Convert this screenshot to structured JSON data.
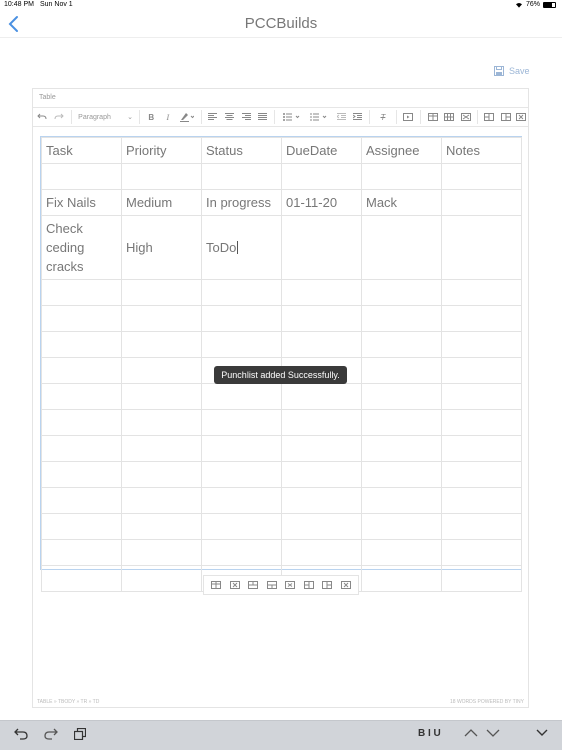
{
  "status_bar": {
    "time": "10:48 PM",
    "date": "Sun Nov 1",
    "battery": "76%",
    "battery_level": 0.76
  },
  "nav": {
    "title": "PCCBuilds",
    "back_icon": "chevron-left-icon"
  },
  "save_label": "Save",
  "editor": {
    "label": "Table",
    "block_format": "Paragraph",
    "table": {
      "headers": [
        "Task",
        "Priority",
        "Status",
        "DueDate",
        "Assignee",
        "Notes"
      ],
      "rows": [
        [
          "",
          "",
          "",
          "",
          "",
          ""
        ],
        [
          "Fix Nails",
          "Medium",
          "In progress",
          "01-11-20",
          "Mack",
          ""
        ],
        [
          "Check ceding cracks",
          "High",
          "ToDo",
          "",
          "",
          ""
        ],
        [
          "",
          "",
          "",
          "",
          "",
          ""
        ],
        [
          "",
          "",
          "",
          "",
          "",
          ""
        ],
        [
          "",
          "",
          "",
          "",
          "",
          ""
        ],
        [
          "",
          "",
          "",
          "",
          "",
          ""
        ],
        [
          "",
          "",
          "",
          "",
          "",
          ""
        ],
        [
          "",
          "",
          "",
          "",
          "",
          ""
        ],
        [
          "",
          "",
          "",
          "",
          "",
          ""
        ],
        [
          "",
          "",
          "",
          "",
          "",
          ""
        ],
        [
          "",
          "",
          "",
          "",
          "",
          ""
        ],
        [
          "",
          "",
          "",
          "",
          "",
          ""
        ],
        [
          "",
          "",
          "",
          "",
          "",
          ""
        ],
        [
          "",
          "",
          "",
          "",
          "",
          ""
        ]
      ]
    },
    "toast": "Punchlist added Successfully.",
    "footer_path": "TABLE » TBODY » TR » TD",
    "footer_words": "18 WORDS  POWERED BY TINY"
  },
  "keyboard_bar": {
    "format_label": "B I U"
  },
  "colors": {
    "accent": "#4a90e2",
    "save": "#9cb6d6",
    "table_focus": "#b9d3ef"
  }
}
